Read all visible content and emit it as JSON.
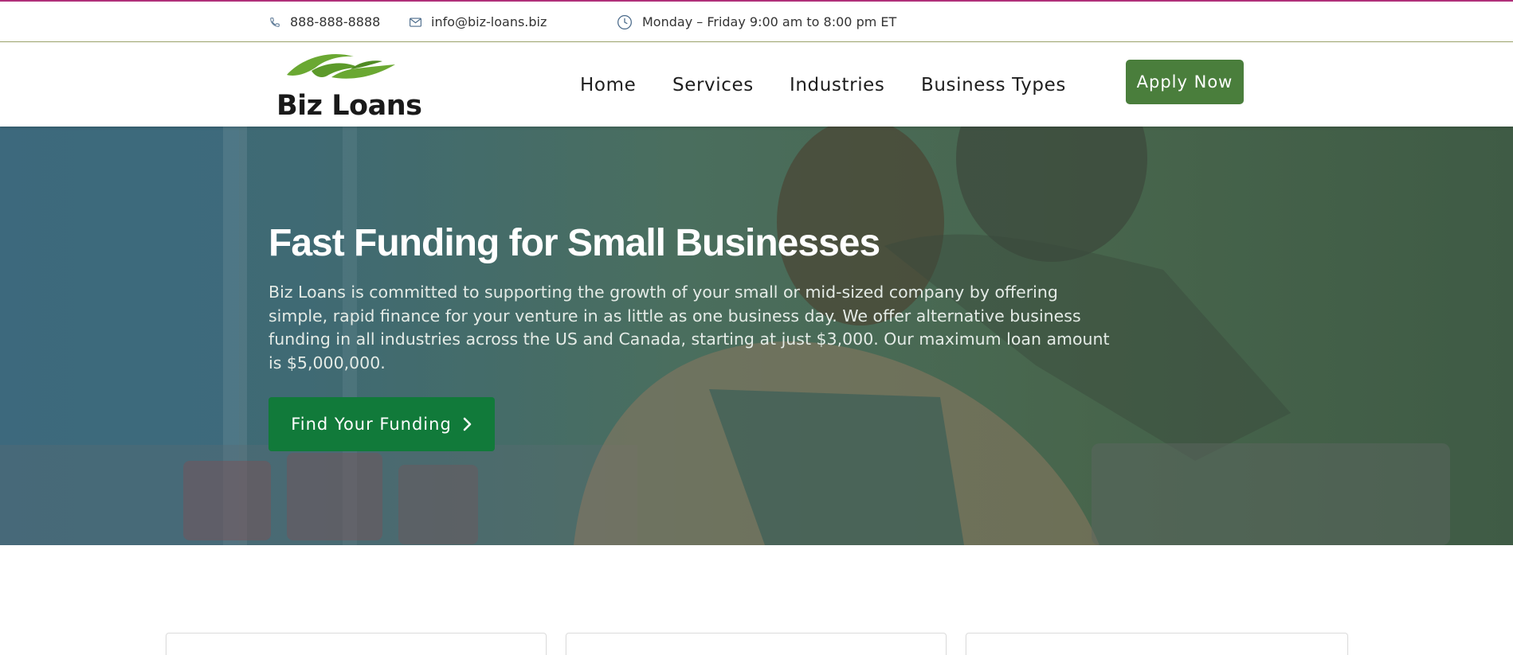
{
  "topbar": {
    "phone": "888-888-8888",
    "email": "info@biz-loans.biz",
    "hours": "Monday – Friday 9:00 am to 8:00 pm ET",
    "icons": [
      "phone-icon",
      "mail-icon",
      "clock-icon"
    ]
  },
  "brand": {
    "name": "Biz Loans",
    "logo_colors": [
      "#6aa832",
      "#4f8a24"
    ]
  },
  "nav": {
    "items": [
      {
        "label": "Home"
      },
      {
        "label": "Services"
      },
      {
        "label": "Industries"
      },
      {
        "label": "Business Types"
      }
    ],
    "cta_label": "Apply Now"
  },
  "hero": {
    "title": "Fast Funding for Small Businesses",
    "text": "Biz Loans is committed to supporting the growth of your small or mid-sized company by offering simple, rapid finance for your venture in as little as one business day. We offer alternative business funding in all industries across the US and Canada, starting at just $3,000. Our maximum loan amount is $5,000,000.",
    "button_label": "Find Your Funding"
  },
  "colors": {
    "apply_button": "#4a7e3c",
    "cta_button": "#117a3a",
    "top_accent": "#b0307a"
  }
}
